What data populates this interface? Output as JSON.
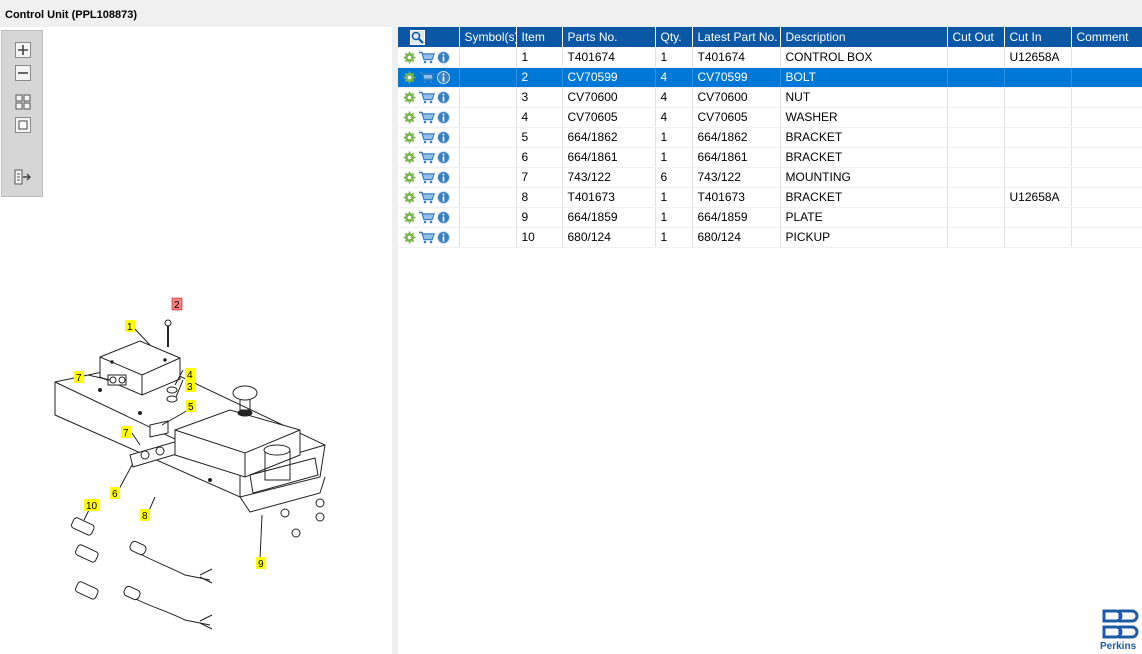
{
  "window": {
    "title": "Control Unit (PPL108873)"
  },
  "toolbox": {
    "tools": [
      "zoom-in",
      "zoom-out",
      "fit-all",
      "actual-size",
      "export"
    ]
  },
  "table": {
    "columns": [
      "",
      "Symbol(s)",
      "Item",
      "Parts No.",
      "Qty.",
      "Latest Part No.",
      "Description",
      "Cut Out",
      "Cut In",
      "Comment"
    ],
    "rows": [
      {
        "item": "1",
        "parts_no": "T401674",
        "qty": "1",
        "latest": "T401674",
        "description": "CONTROL BOX",
        "cut_out": "",
        "cut_in": "U12658A",
        "comment": ""
      },
      {
        "item": "2",
        "parts_no": "CV70599",
        "qty": "4",
        "latest": "CV70599",
        "description": "BOLT",
        "cut_out": "",
        "cut_in": "",
        "comment": ""
      },
      {
        "item": "3",
        "parts_no": "CV70600",
        "qty": "4",
        "latest": "CV70600",
        "description": "NUT",
        "cut_out": "",
        "cut_in": "",
        "comment": ""
      },
      {
        "item": "4",
        "parts_no": "CV70605",
        "qty": "4",
        "latest": "CV70605",
        "description": "WASHER",
        "cut_out": "",
        "cut_in": "",
        "comment": ""
      },
      {
        "item": "5",
        "parts_no": "664/1862",
        "qty": "1",
        "latest": "664/1862",
        "description": "BRACKET",
        "cut_out": "",
        "cut_in": "",
        "comment": ""
      },
      {
        "item": "6",
        "parts_no": "664/1861",
        "qty": "1",
        "latest": "664/1861",
        "description": "BRACKET",
        "cut_out": "",
        "cut_in": "",
        "comment": ""
      },
      {
        "item": "7",
        "parts_no": "743/122",
        "qty": "6",
        "latest": "743/122",
        "description": "MOUNTING",
        "cut_out": "",
        "cut_in": "",
        "comment": ""
      },
      {
        "item": "8",
        "parts_no": "T401673",
        "qty": "1",
        "latest": "T401673",
        "description": "BRACKET",
        "cut_out": "",
        "cut_in": "U12658A",
        "comment": ""
      },
      {
        "item": "9",
        "parts_no": "664/1859",
        "qty": "1",
        "latest": "664/1859",
        "description": "PLATE",
        "cut_out": "",
        "cut_in": "",
        "comment": ""
      },
      {
        "item": "10",
        "parts_no": "680/124",
        "qty": "1",
        "latest": "680/124",
        "description": "PICKUP",
        "cut_out": "",
        "cut_in": "",
        "comment": ""
      }
    ],
    "selected_row": 1
  },
  "drawing": {
    "callouts": [
      "1",
      "2",
      "3",
      "4",
      "5",
      "6",
      "7",
      "7",
      "8",
      "9",
      "10"
    ],
    "highlighted_callout": "2"
  },
  "brand": {
    "name": "Perkins",
    "color": "#1f5aa6"
  },
  "colors": {
    "header": "#0a57a6",
    "selection": "#0078d7",
    "callout": "#ffff00",
    "callout_highlight": "#ff8080",
    "settings_icon": "#7ab648"
  }
}
